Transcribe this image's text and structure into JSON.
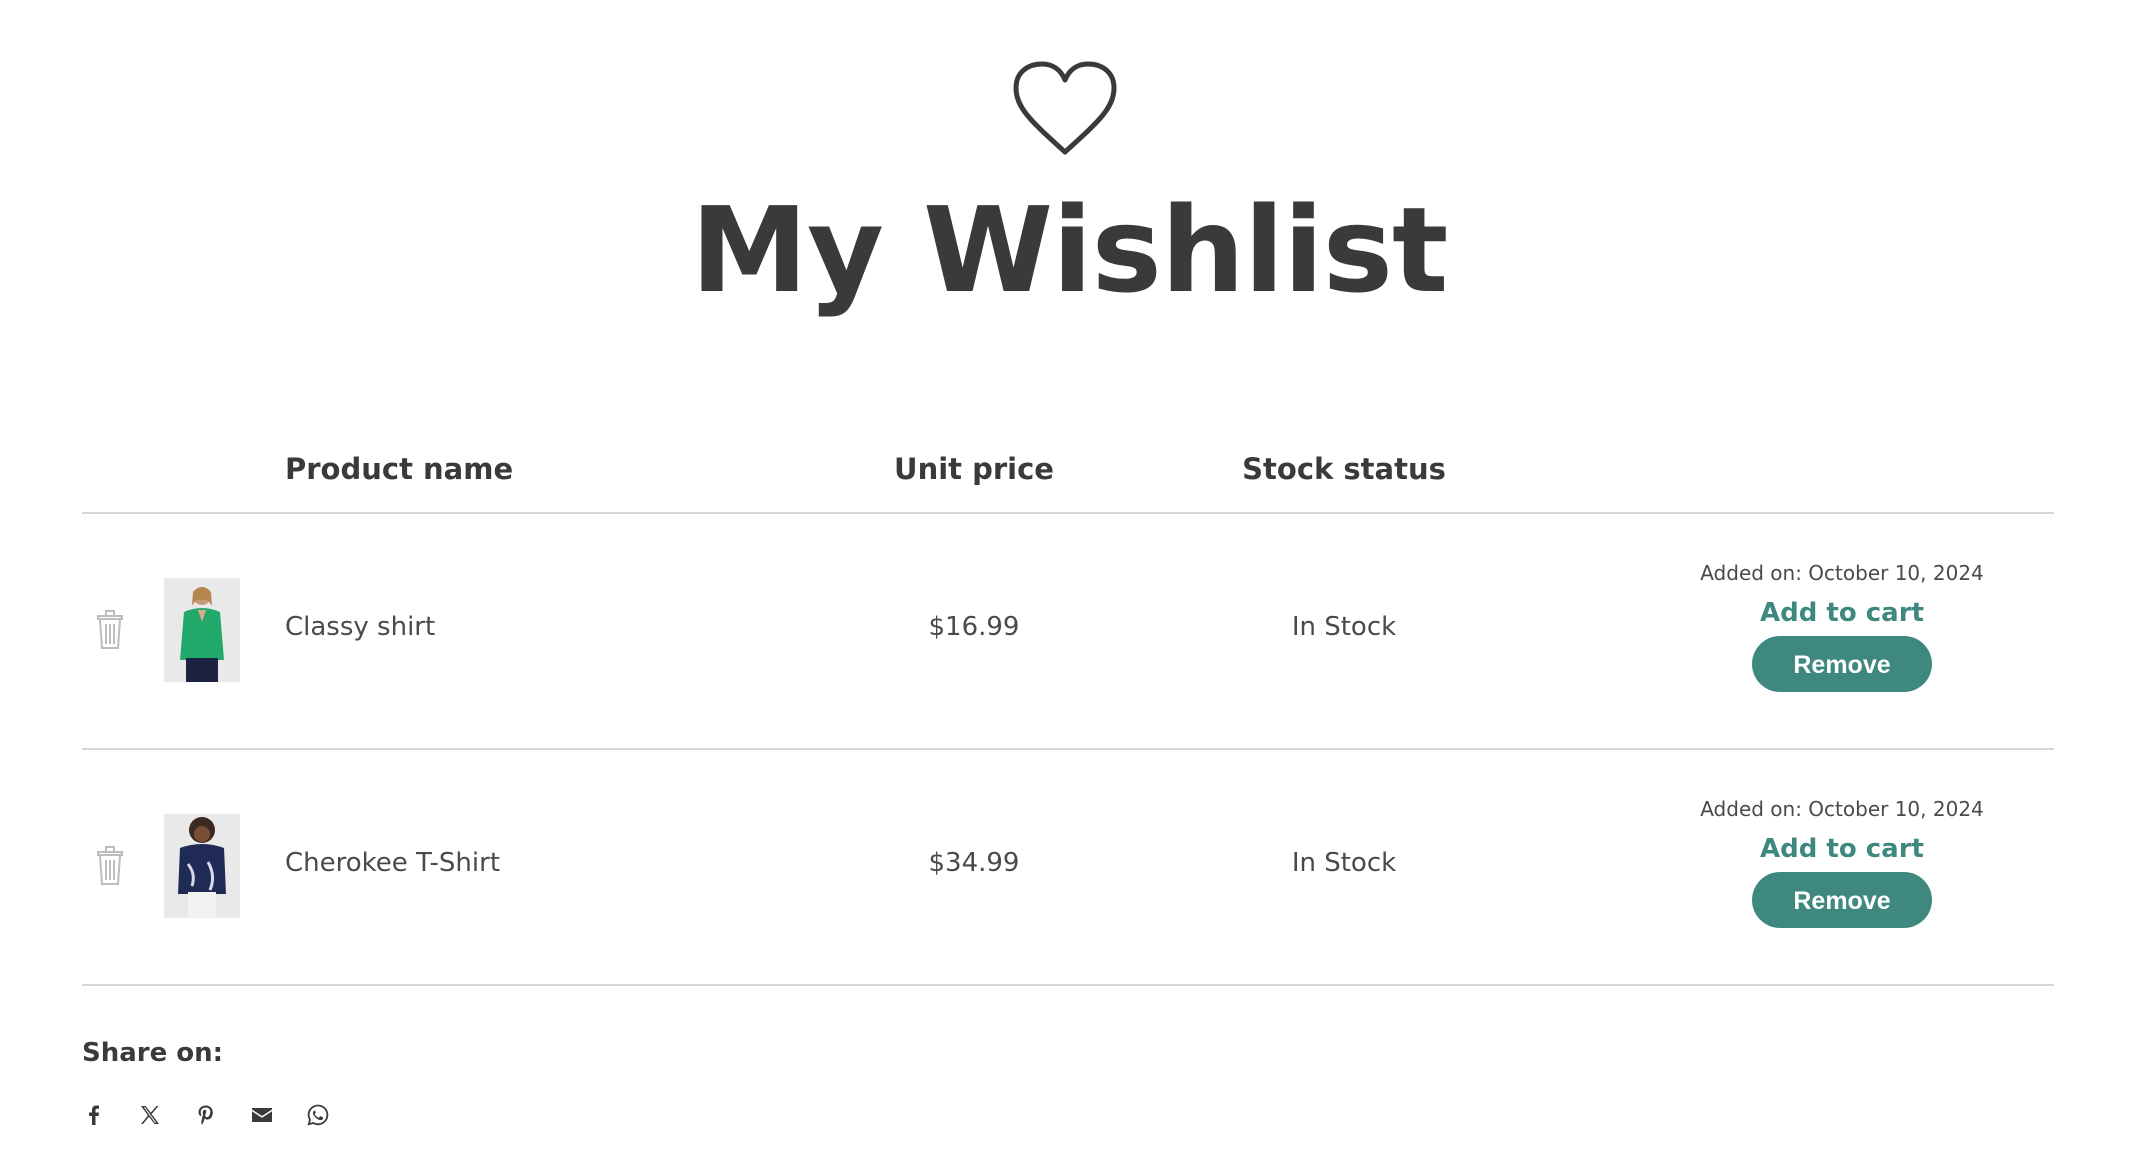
{
  "page": {
    "title": "My Wishlist",
    "heart_icon": "heart-outline-icon"
  },
  "table": {
    "headers": {
      "name": "Product name",
      "price": "Unit price",
      "stock": "Stock status"
    },
    "rows": [
      {
        "name": "Classy shirt",
        "price": "$16.99",
        "stock": "In Stock",
        "added": "Added on: October 10, 2024",
        "add_to_cart": "Add to cart",
        "remove": "Remove",
        "thumb_color": "#22a86a",
        "thumb_pants": "#1c2340"
      },
      {
        "name": "Cherokee T-Shirt",
        "price": "$34.99",
        "stock": "In Stock",
        "added": "Added on: October 10, 2024",
        "add_to_cart": "Add to cart",
        "remove": "Remove",
        "thumb_color": "#1f2a55",
        "thumb_pants": "#f2f2f2"
      }
    ]
  },
  "share": {
    "label": "Share on:",
    "icons": [
      "facebook-icon",
      "x-icon",
      "pinterest-icon",
      "email-icon",
      "whatsapp-icon"
    ]
  },
  "colors": {
    "accent": "#3e8880",
    "text": "#3a3a3a",
    "divider": "#d6d6d6"
  }
}
